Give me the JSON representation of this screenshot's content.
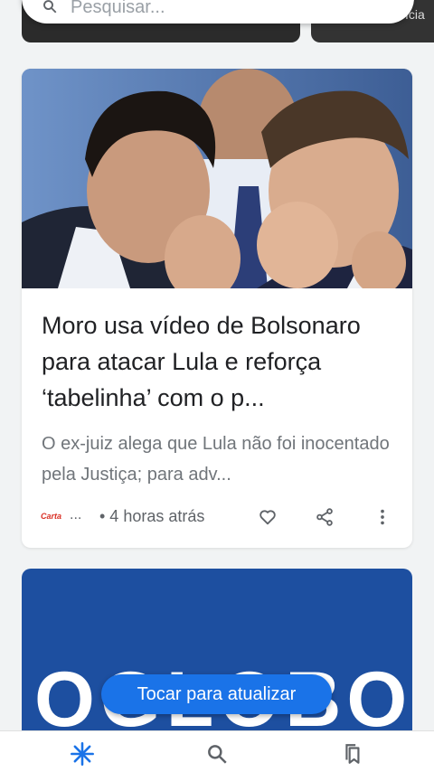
{
  "search": {
    "placeholder": "Pesquisar..."
  },
  "top_right_text": "ícia",
  "article": {
    "title": "Moro usa vídeo de Bolsonaro para atacar Lula e reforça ‘tabelinha’ com o p...",
    "snippet": "O ex-juiz alega que Lula não foi inocentado pela Justiça; para adv...",
    "source_logo_text": "Carta",
    "source_ellipsis": "...",
    "time": "• 4 horas atrás",
    "image_icon": "photo-moro-bolsonaro"
  },
  "second_card": {
    "logo_text": "OGLOBO"
  },
  "toast": {
    "label": "Tocar para atualizar"
  },
  "bottom_nav": {
    "items": [
      {
        "name": "discover",
        "icon": "asterisk-icon",
        "active": true
      },
      {
        "name": "search",
        "icon": "search-icon",
        "active": false
      },
      {
        "name": "collections",
        "icon": "bookmarks-icon",
        "active": false
      }
    ]
  },
  "colors": {
    "accent": "#1a73e8",
    "source": "#d93025",
    "globo_bg": "#1d4fa0"
  }
}
